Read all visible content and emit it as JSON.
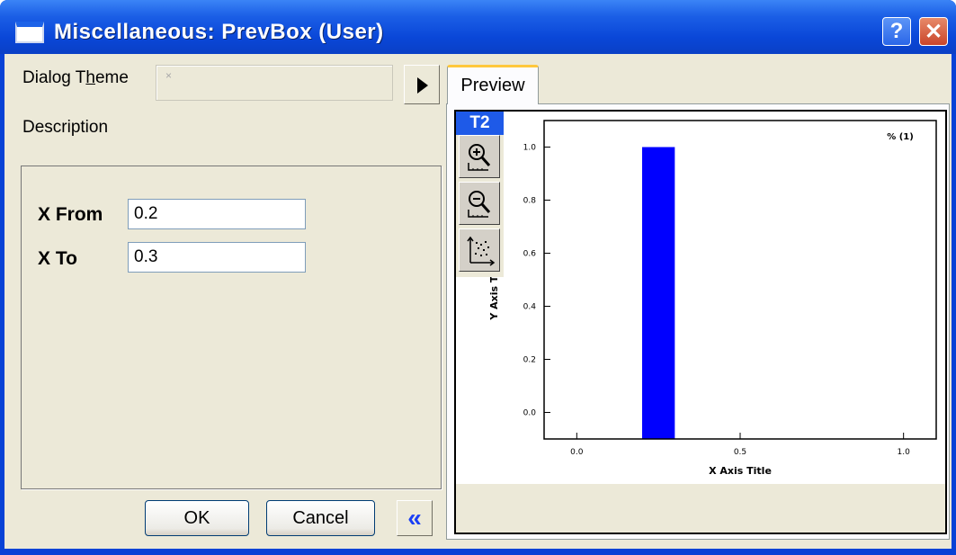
{
  "window": {
    "title": "Miscellaneous: PrevBox (User)",
    "help_glyph": "?",
    "close_glyph": "✕"
  },
  "dialog": {
    "theme_label": "Dialog Theme",
    "theme_value": "×",
    "description_label": "Description",
    "fields": [
      {
        "label": "X From",
        "value": "0.2"
      },
      {
        "label": "X To",
        "value": "0.3"
      }
    ],
    "ok_label": "OK",
    "cancel_label": "Cancel",
    "collapse_glyph": "«"
  },
  "preview": {
    "tab_label": "Preview",
    "layer_badge": "T2",
    "tools": [
      "zoom-in-icon",
      "zoom-out-icon",
      "rescale-icon"
    ]
  },
  "chart_data": {
    "type": "area",
    "series": [
      {
        "name": "% (1)",
        "x": [
          0.2,
          0.3
        ],
        "y": [
          1.0,
          1.0
        ]
      }
    ],
    "xlabel": "X Axis Title",
    "ylabel": "Y Axis Title",
    "xlim": [
      -0.1,
      1.1
    ],
    "ylim": [
      -0.1,
      1.1
    ],
    "x_ticks": [
      {
        "value": 0.0,
        "label": "0.0"
      },
      {
        "value": 0.5,
        "label": "0.5"
      },
      {
        "value": 1.0,
        "label": "1.0"
      }
    ],
    "y_ticks": [
      {
        "value": 0.0,
        "label": "0.0"
      },
      {
        "value": 0.2,
        "label": "0.2"
      },
      {
        "value": 0.4,
        "label": "0.4"
      },
      {
        "value": 0.6,
        "label": "0.6"
      },
      {
        "value": 0.8,
        "label": "0.8"
      },
      {
        "value": 1.0,
        "label": "1.0"
      }
    ],
    "legend": "top-right",
    "grid": false,
    "fill_color": "#0000ff"
  }
}
